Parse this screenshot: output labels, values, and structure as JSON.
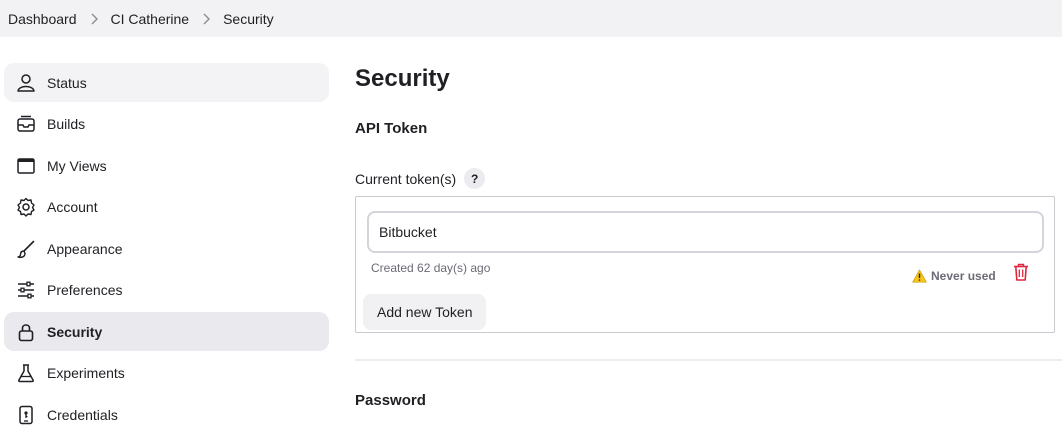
{
  "breadcrumb": {
    "items": [
      "Dashboard",
      "CI Catherine",
      "Security"
    ]
  },
  "sidebar": {
    "items": [
      {
        "label": "Status",
        "icon": "user-icon"
      },
      {
        "label": "Builds",
        "icon": "builds-tray-icon"
      },
      {
        "label": "My Views",
        "icon": "window-icon"
      },
      {
        "label": "Account",
        "icon": "gear-icon"
      },
      {
        "label": "Appearance",
        "icon": "brush-icon"
      },
      {
        "label": "Preferences",
        "icon": "sliders-icon"
      },
      {
        "label": "Security",
        "icon": "lock-icon",
        "active": true
      },
      {
        "label": "Experiments",
        "icon": "flask-icon"
      },
      {
        "label": "Credentials",
        "icon": "phone-key-icon"
      }
    ]
  },
  "main": {
    "title": "Security",
    "api_token_title": "API Token",
    "current_tokens_label": "Current token(s)",
    "help_label": "?",
    "token": {
      "name": "Bitbucket",
      "created": "Created 62 day(s) ago",
      "usage": "Never used"
    },
    "add_token_label": "Add new Token",
    "password_title": "Password"
  },
  "colors": {
    "accent_danger": "#e0263d",
    "warning": "#f5c518",
    "active_bg": "#e9e9ee"
  }
}
